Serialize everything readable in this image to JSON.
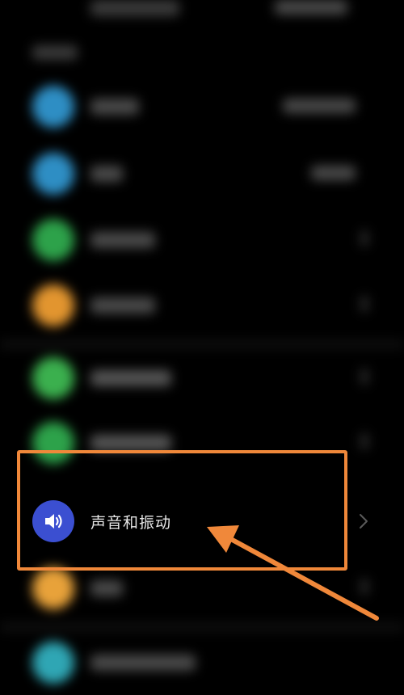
{
  "settings": {
    "sound_item": {
      "label": "声音和振动",
      "icon": "speaker-icon",
      "icon_color": "#3b4fd1"
    }
  },
  "annotation": {
    "highlight_color": "#f0883a"
  }
}
